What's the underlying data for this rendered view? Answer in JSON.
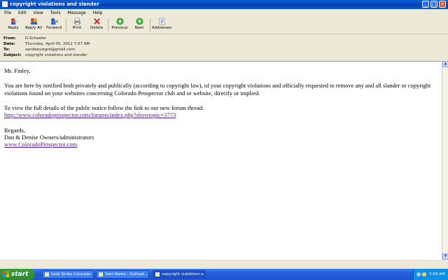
{
  "window": {
    "title": "copyright violations and slander"
  },
  "menu": [
    "File",
    "Edit",
    "View",
    "Tools",
    "Message",
    "Help"
  ],
  "toolbar": {
    "reply": "Reply",
    "reply_all": "Reply All",
    "forward": "Forward",
    "print": "Print",
    "delete": "Delete",
    "previous": "Previous",
    "next": "Next",
    "addresses": "Addresses"
  },
  "headers": {
    "from_label": "From:",
    "from": "D.Schaefer",
    "date_label": "Date:",
    "date": "Thursday, April 05, 2012 7:57 AM",
    "to_label": "To:",
    "to": "sandeeywgre@gmail.com",
    "subject_label": "Subject:",
    "subject": "copyright violations and slander"
  },
  "message": {
    "greeting": "Mr. Finley,",
    "paragraph1": "You are here by notified both privately and publically (according to copyright law), of your copyright violations and officially requested to remove any and all slander or copyright violations found on your websites concerning Colorado Prospector club and or website, directly or implied.",
    "paragraph2": "To view the full details of the public notice follow the link to our new forum thread.",
    "forum_link": "http://www.coloradoprospector.com/forums/index.php?showtopic=3773",
    "regards": "Regards,",
    "signature": "Dan & Denise Owners/administrators",
    "site_link": "www.ColoradoProspector.com"
  },
  "taskbar": {
    "start": "start",
    "tasks": [
      "Gold Strike Colorado ...",
      "Sent Items - Outlook ...",
      "copyright violations a..."
    ],
    "clock": "7:59 AM"
  },
  "colors": {
    "titlebar": "#0842b5",
    "taskbar": "#245edb",
    "start": "#3c9a3c",
    "link": "#551a8b"
  }
}
